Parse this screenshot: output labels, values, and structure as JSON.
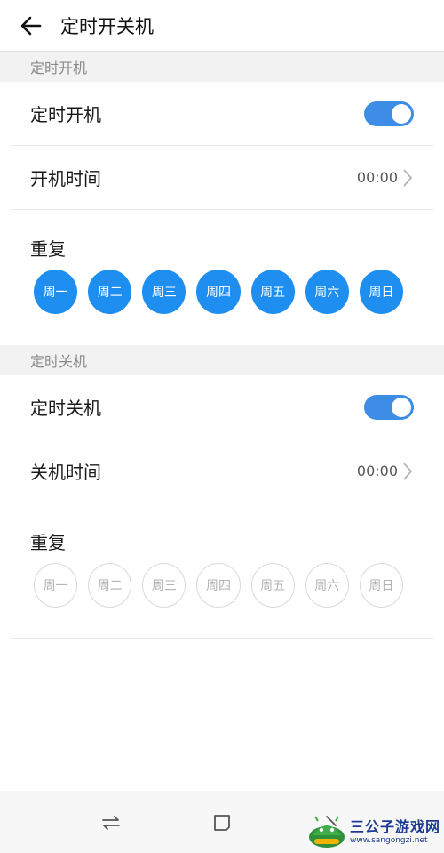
{
  "header": {
    "title": "定时开关机"
  },
  "power_on": {
    "section_label": "定时开机",
    "toggle_label": "定时开机",
    "toggle_on": true,
    "time_label": "开机时间",
    "time_value": "00:00",
    "repeat_label": "重复",
    "days": [
      {
        "label": "周一",
        "selected": true
      },
      {
        "label": "周二",
        "selected": true
      },
      {
        "label": "周三",
        "selected": true
      },
      {
        "label": "周四",
        "selected": true
      },
      {
        "label": "周五",
        "selected": true
      },
      {
        "label": "周六",
        "selected": true
      },
      {
        "label": "周日",
        "selected": true
      }
    ]
  },
  "power_off": {
    "section_label": "定时关机",
    "toggle_label": "定时关机",
    "toggle_on": true,
    "time_label": "关机时间",
    "time_value": "00:00",
    "repeat_label": "重复",
    "days": [
      {
        "label": "周一",
        "selected": false
      },
      {
        "label": "周二",
        "selected": false
      },
      {
        "label": "周三",
        "selected": false
      },
      {
        "label": "周四",
        "selected": false
      },
      {
        "label": "周五",
        "selected": false
      },
      {
        "label": "周六",
        "selected": false
      },
      {
        "label": "周日",
        "selected": false
      }
    ]
  },
  "navbar": {
    "icons": [
      "switch-apps-icon",
      "home-icon",
      "back-icon"
    ]
  },
  "watermark": {
    "title": "三公子游戏网",
    "url": "www.sangongzi.net"
  },
  "colors": {
    "accent": "#1e8ff0",
    "toggle": "#3d8de6",
    "section_bg": "#f2f2f2"
  }
}
